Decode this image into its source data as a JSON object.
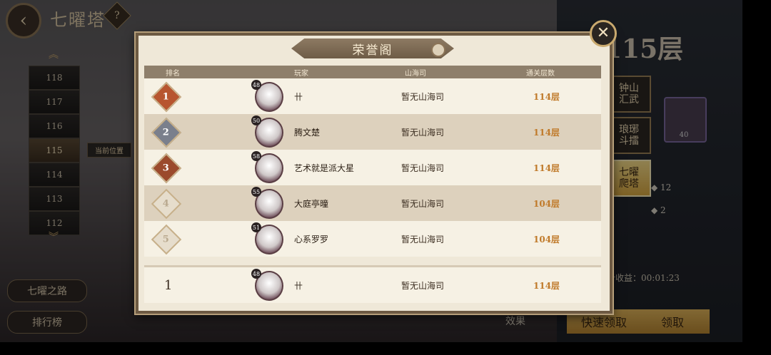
{
  "header": {
    "title": "七曜塔",
    "help": "?"
  },
  "floors": [
    "118",
    "117",
    "116",
    "115",
    "114",
    "113",
    "112"
  ],
  "current_floor": "115",
  "current_label": "当前位置",
  "left_buttons": {
    "road": "七曜之路",
    "rank": "排行榜"
  },
  "right": {
    "floor_big": "115层",
    "tabs": [
      "钟山\n汇武",
      "琅琊\n斗擂",
      "七曜\n爬塔"
    ],
    "item_count": "40",
    "res1": "12",
    "res2": "2",
    "timer": "计收益：00:01:23",
    "quick_btn": "快速领取",
    "claim_btn": "领取",
    "effect": "效果"
  },
  "modal": {
    "title": "荣誉阁",
    "close": "✕",
    "columns": {
      "rank": "排名",
      "player": "玩家",
      "sh": "山海司",
      "floor": "通关层数"
    },
    "rows": [
      {
        "rank": "1",
        "level": "48",
        "name": "卄",
        "sh": "暂无山海司",
        "floor": "114层"
      },
      {
        "rank": "2",
        "level": "50",
        "name": "腾文楚",
        "sh": "暂无山海司",
        "floor": "114层"
      },
      {
        "rank": "3",
        "level": "58",
        "name": "艺术就是派大星",
        "sh": "暂无山海司",
        "floor": "114层"
      },
      {
        "rank": "4",
        "level": "55",
        "name": "大庭亭曈",
        "sh": "暂无山海司",
        "floor": "104层"
      },
      {
        "rank": "5",
        "level": "51",
        "name": "心系罗罗",
        "sh": "暂无山海司",
        "floor": "104层"
      }
    ],
    "my_row": {
      "rank": "1",
      "level": "48",
      "name": "卄",
      "sh": "暂无山海司",
      "floor": "114层"
    }
  }
}
